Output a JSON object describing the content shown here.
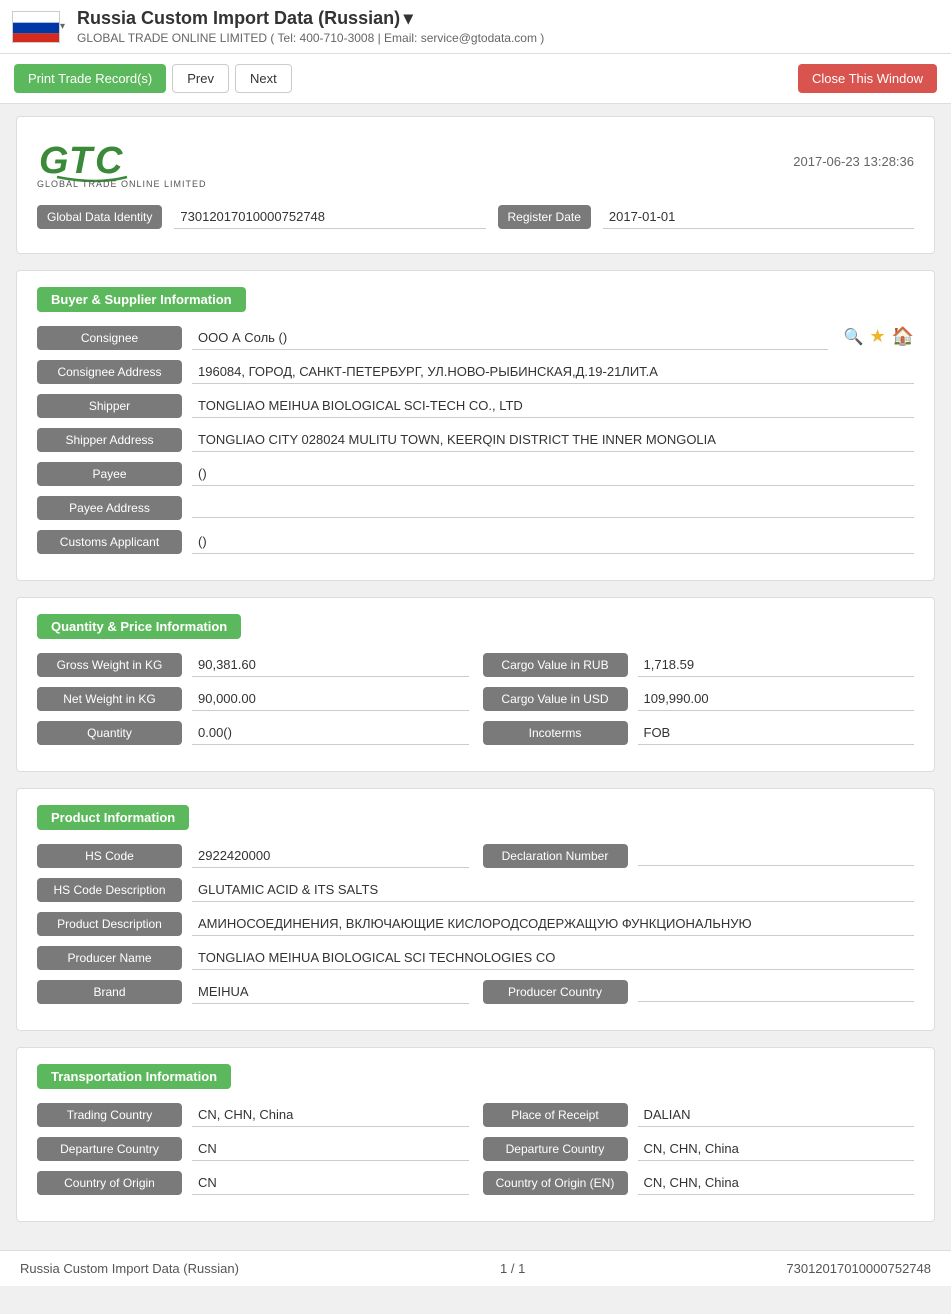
{
  "topBar": {
    "title": "Russia Custom Import Data (Russian)",
    "titleArrow": "▾",
    "subtitle": "GLOBAL TRADE ONLINE LIMITED ( Tel: 400-710-3008 | Email: service@gtodata.com )"
  },
  "toolbar": {
    "printLabel": "Print Trade Record(s)",
    "prevLabel": "Prev",
    "nextLabel": "Next",
    "closeLabel": "Close This Window"
  },
  "record": {
    "timestamp": "2017-06-23 13:28:36",
    "logoText": "GTC",
    "logoSub": "GLOBAL TRADE ONLINE LIMITED",
    "globalDataIdentityLabel": "Global Data Identity",
    "globalDataIdentityValue": "73012017010000752748",
    "registerDateLabel": "Register Date",
    "registerDateValue": "2017-01-01"
  },
  "buyerSupplier": {
    "sectionTitle": "Buyer & Supplier Information",
    "fields": [
      {
        "label": "Consignee",
        "value": "ООО А Соль ()",
        "hasIcons": true
      },
      {
        "label": "Consignee Address",
        "value": "196084, ГОРОД, САНКТ-ПЕТЕРБУРГ, УЛ.НОВО-РЫБИНСКАЯ,Д.19-21ЛИТ.А",
        "hasIcons": false
      },
      {
        "label": "Shipper",
        "value": "TONGLIAO MEIHUA BIOLOGICAL SCI-TECH CO., LTD",
        "hasIcons": false
      },
      {
        "label": "Shipper Address",
        "value": "TONGLIAO CITY 028024 MULITU TOWN, KEERQIN DISTRICT THE INNER MONGOLIA",
        "hasIcons": false
      },
      {
        "label": "Payee",
        "value": "()",
        "hasIcons": false
      },
      {
        "label": "Payee Address",
        "value": "",
        "hasIcons": false
      },
      {
        "label": "Customs Applicant",
        "value": "()",
        "hasIcons": false
      }
    ]
  },
  "quantityPrice": {
    "sectionTitle": "Quantity & Price Information",
    "leftFields": [
      {
        "label": "Gross Weight in KG",
        "value": "90,381.60"
      },
      {
        "label": "Net Weight in KG",
        "value": "90,000.00"
      },
      {
        "label": "Quantity",
        "value": "0.00()"
      }
    ],
    "rightFields": [
      {
        "label": "Cargo Value in RUB",
        "value": "1,718.59"
      },
      {
        "label": "Cargo Value in USD",
        "value": "109,990.00"
      },
      {
        "label": "Incoterms",
        "value": "FOB"
      }
    ]
  },
  "productInfo": {
    "sectionTitle": "Product Information",
    "row1Left": {
      "label": "HS Code",
      "value": "2922420000"
    },
    "row1Right": {
      "label": "Declaration Number",
      "value": ""
    },
    "row2": {
      "label": "HS Code Description",
      "value": "GLUTAMIC ACID & ITS SALTS"
    },
    "row3": {
      "label": "Product Description",
      "value": "АМИНОСОЕДИНЕНИЯ, ВКЛЮЧАЮЩИЕ КИСЛОРОДСОДЕРЖАЩУЮ ФУНКЦИОНАЛЬНУЮ"
    },
    "row4": {
      "label": "Producer Name",
      "value": "TONGLIAO MEIHUA BIOLOGICAL SCI TECHNOLOGIES CO"
    },
    "row5Left": {
      "label": "Brand",
      "value": "MEIHUA"
    },
    "row5Right": {
      "label": "Producer Country",
      "value": ""
    }
  },
  "transportation": {
    "sectionTitle": "Transportation Information",
    "leftFields": [
      {
        "label": "Trading Country",
        "value": "CN, CHN, China"
      },
      {
        "label": "Departure Country",
        "value": "CN"
      },
      {
        "label": "Country of Origin",
        "value": "CN"
      }
    ],
    "rightFields": [
      {
        "label": "Place of Receipt",
        "value": "DALIAN"
      },
      {
        "label": "Departure Country",
        "value": "CN, CHN, China"
      },
      {
        "label": "Country of Origin (EN)",
        "value": "CN, CHN, China"
      }
    ]
  },
  "footer": {
    "left": "Russia Custom Import Data (Russian)",
    "center": "1 / 1",
    "right": "73012017010000752748"
  }
}
